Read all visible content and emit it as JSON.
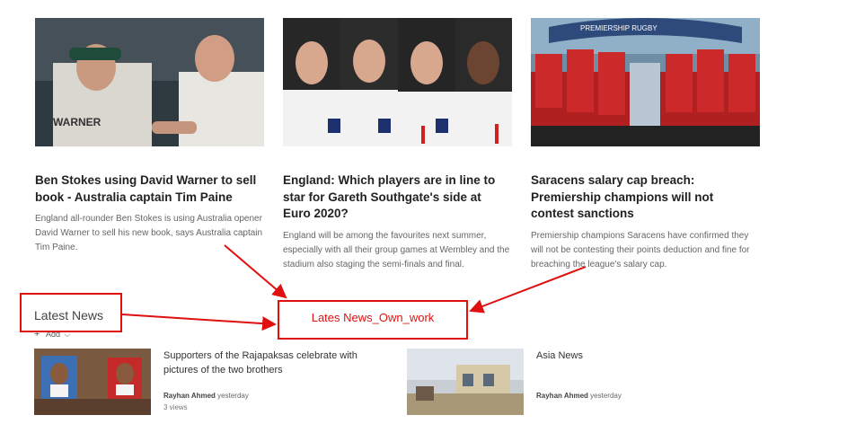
{
  "cards": [
    {
      "title": "Ben Stokes using David Warner to sell book - Australia captain Tim Paine",
      "description": "England all-rounder Ben Stokes is using Australia opener David Warner to sell his new book, says Australia captain Tim Paine."
    },
    {
      "title": "England: Which players are in line to star for Gareth Southgate's side at Euro 2020?",
      "description": "England will be among the favourites next summer, especially with all their group games at Wembley and the stadium also staging the semi-finals and final."
    },
    {
      "title": "Saracens salary cap breach: Premiership champions will not contest sanctions",
      "description": "Premiership champions Saracens have confirmed they will not be contesting their points deduction and fine for breaching the league's salary cap."
    }
  ],
  "section": {
    "title": "Latest News",
    "add_label": "Add"
  },
  "news": [
    {
      "title": "Supporters of the Rajapaksas celebrate with pictures of the two brothers",
      "author": "Rayhan Ahmed",
      "time": "yesterday",
      "views": "3 views"
    },
    {
      "title": "Asia News",
      "author": "Rayhan Ahmed",
      "time": "yesterday"
    }
  ],
  "annotation": {
    "label": "Lates News_Own_work",
    "color": "#e01010"
  }
}
